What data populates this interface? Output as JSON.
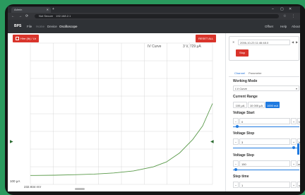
{
  "browser": {
    "tab_title": "Admin",
    "tab_close": "✕",
    "new_tab": "+",
    "minimize": "–",
    "maximize": "▢",
    "close": "✕",
    "back": "←",
    "forward": "→",
    "reload": "⟳",
    "security_label": "Not Secure",
    "url": "192.168.2.1",
    "bookmark": "☆",
    "menu": "⋮"
  },
  "app": {
    "brand": "BPS",
    "nav": [
      "File",
      "Home",
      "Device",
      "Oscilloscope"
    ],
    "nav_right": [
      "Offset",
      "Help",
      "About"
    ]
  },
  "plot": {
    "hold_label": "Hire (Ib) / Lh",
    "reset_label": "RESET ALL",
    "curve_label": "IV Curve",
    "readout": "3 V, 729 μA",
    "y_min_label": "100 μA",
    "x_min_label": "232.934 mV",
    "marker_left": "▶",
    "marker_right": "◀",
    "line_color": "#5a9a4a"
  },
  "panel": {
    "close": "✕",
    "datetime": "2006-10-23 11:46:48.0",
    "arrow_left": "◀",
    "arrow_right": "▶",
    "stop_label": "Stop",
    "tabs": [
      "Channel",
      "Parameter"
    ],
    "working_mode_label": "Working Mode",
    "working_mode_value": "I-V Curve",
    "select_chevron": "▾",
    "current_range_label": "Current Range",
    "current_ranges": [
      "100 μA",
      "10 000 μA",
      "1000 mA"
    ],
    "voltage_start_label": "Voltage Start",
    "voltage_start_value": "0",
    "voltage_stop_label": "Voltage Stop",
    "voltage_stop_value": "3",
    "voltage_step_label": "Voltage Step",
    "voltage_step_value": "150",
    "step_time_label": "Step time",
    "step_time_value": "1",
    "minus": "−",
    "plus": "+",
    "unit_v": "V",
    "unit_mv": "mV",
    "unit_s": "s",
    "accent_color": "#1f7ae0",
    "danger_color": "#d9342b"
  },
  "chart_data": {
    "type": "line",
    "title": "",
    "xlabel": "",
    "ylabel": "",
    "x_min": 232.934,
    "x_unit": "mV",
    "x_max": 3000,
    "x_max_unit": "mV",
    "y_min": 100,
    "y_min_unit": "μA",
    "y_max_shown": 729,
    "y_max_unit": "μA",
    "grid": true,
    "series": [
      {
        "values_x_mV": [
          232.9,
          300,
          600,
          900,
          1200,
          1500,
          1800,
          2100,
          2300,
          2500,
          2700,
          2850,
          3000
        ],
        "values_y_uA": [
          140,
          140,
          141,
          143,
          146,
          151,
          160,
          178,
          200,
          240,
          300,
          360,
          460
        ]
      }
    ]
  }
}
